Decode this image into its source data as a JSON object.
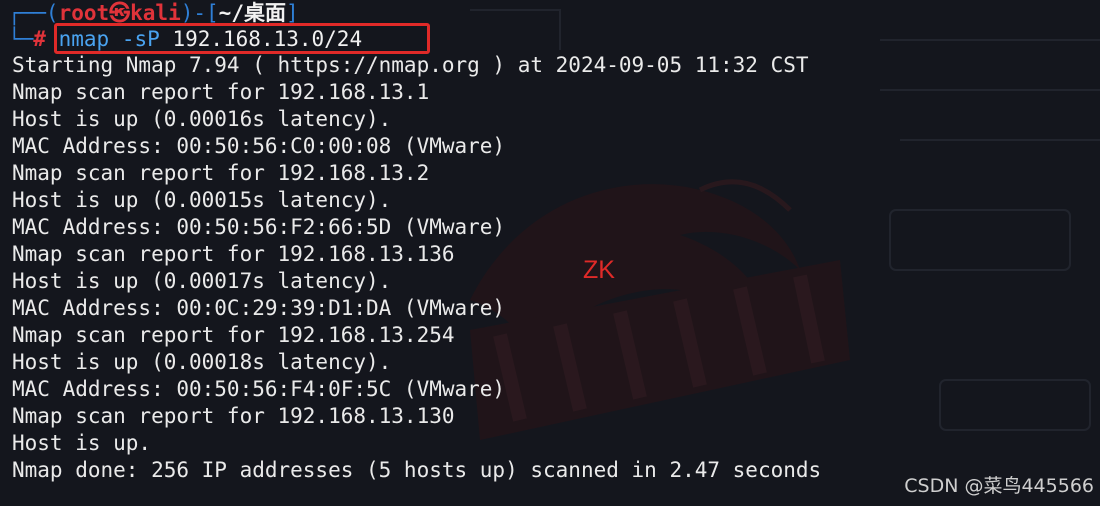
{
  "prompt": {
    "corner_top": "┌──(",
    "user": "root㉿kali",
    "mid": ")-[",
    "dir": "~/桌面",
    "end": "]",
    "corner_bottom": "└─",
    "hash": "#"
  },
  "command": {
    "name": "nmap",
    "flag": "-sP",
    "arg": "192.168.13.0/24"
  },
  "output": [
    "Starting Nmap 7.94 ( https://nmap.org ) at 2024-09-05 11:32 CST",
    "Nmap scan report for 192.168.13.1",
    "Host is up (0.00016s latency).",
    "MAC Address: 00:50:56:C0:00:08 (VMware)",
    "Nmap scan report for 192.168.13.2",
    "Host is up (0.00015s latency).",
    "MAC Address: 00:50:56:F2:66:5D (VMware)",
    "Nmap scan report for 192.168.13.136",
    "Host is up (0.00017s latency).",
    "MAC Address: 00:0C:29:39:D1:DA (VMware)",
    "Nmap scan report for 192.168.13.254",
    "Host is up (0.00018s latency).",
    "MAC Address: 00:50:56:F4:0F:5C (VMware)",
    "Nmap scan report for 192.168.13.130",
    "Host is up.",
    "Nmap done: 256 IP addresses (5 hosts up) scanned in 2.47 seconds"
  ],
  "annotation": "ZK",
  "watermark": "CSDN @菜鸟445566",
  "colors": {
    "background": "#14161d",
    "prompt_blue": "#2f7fd6",
    "prompt_red": "#e0333a",
    "highlight_box": "#e02a28",
    "text": "#eaeaea"
  }
}
